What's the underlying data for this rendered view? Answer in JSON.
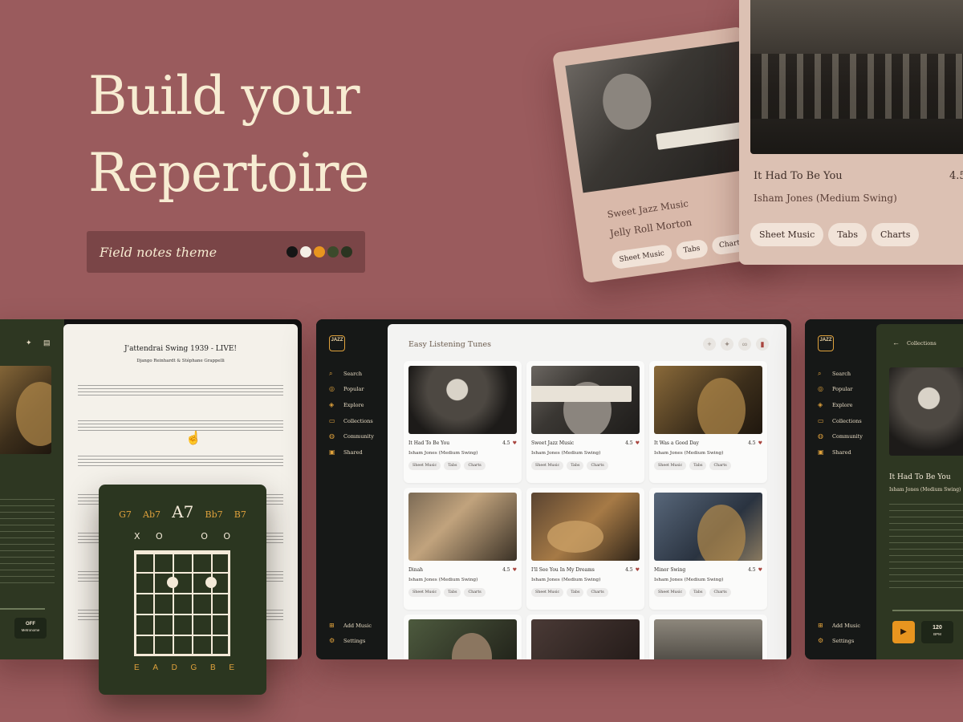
{
  "hero": {
    "title_line1": "Build your",
    "title_line2": "Repertoire"
  },
  "theme": {
    "label": "Field notes theme",
    "swatches": [
      "#151515",
      "#f4efe6",
      "#e8951f",
      "#3b4a2b",
      "#2a3420"
    ]
  },
  "card_a": {
    "title": "Sweet Jazz Music",
    "artist": "Jelly Roll Morton",
    "chips": [
      "Sheet Music",
      "Tabs",
      "Charts"
    ]
  },
  "card_b": {
    "title": "It Had To Be You",
    "rating": "4.5",
    "artist": "Isham Jones (Medium Swing)",
    "chips": [
      "Sheet Music",
      "Tabs",
      "Charts"
    ]
  },
  "nav": {
    "items": [
      {
        "label": "Search",
        "icon": "search-icon"
      },
      {
        "label": "Popular",
        "icon": "popular-icon"
      },
      {
        "label": "Explore",
        "icon": "explore-icon"
      },
      {
        "label": "Collections",
        "icon": "folder-icon"
      },
      {
        "label": "Community",
        "icon": "community-icon"
      },
      {
        "label": "Shared",
        "icon": "shared-icon"
      }
    ],
    "bottom": [
      {
        "label": "Add Music",
        "icon": "plus-icon"
      },
      {
        "label": "Settings",
        "icon": "gear-icon"
      }
    ]
  },
  "logo_text": "JAZZ",
  "main": {
    "title": "Easy Listening Tunes",
    "tiles": [
      {
        "title": "It Had To Be You",
        "artist": "Isham Jones (Medium Swing)",
        "rating": "4.5",
        "chips": [
          "Sheet Music",
          "Tabs",
          "Charts"
        ]
      },
      {
        "title": "Sweet Jazz Music",
        "artist": "Isham Jones (Medium Swing)",
        "rating": "4.5",
        "chips": [
          "Sheet Music",
          "Tabs",
          "Charts"
        ]
      },
      {
        "title": "It Was a Good Day",
        "artist": "Isham Jones (Medium Swing)",
        "rating": "4.5",
        "chips": [
          "Sheet Music",
          "Tabs",
          "Charts"
        ]
      },
      {
        "title": "Dinah",
        "artist": "Isham Jones (Medium Swing)",
        "rating": "4.5",
        "chips": [
          "Sheet Music",
          "Tabs",
          "Charts"
        ]
      },
      {
        "title": "I'll See You In My Dreams",
        "artist": "Isham Jones (Medium Swing)",
        "rating": "4.5",
        "chips": [
          "Sheet Music",
          "Tabs",
          "Charts"
        ]
      },
      {
        "title": "Minor Swing",
        "artist": "Isham Jones (Medium Swing)",
        "rating": "4.5",
        "chips": [
          "Sheet Music",
          "Tabs",
          "Charts"
        ]
      }
    ]
  },
  "sheet": {
    "title": "J'attendrai Swing 1939 - LIVE!",
    "subtitle": "Django Reinhardt & Stéphane Grappelli",
    "chords": [
      "G7",
      "Ab7",
      "A7",
      "Bb7",
      "B7"
    ],
    "strings": [
      "E",
      "A",
      "D",
      "G",
      "B",
      "E"
    ],
    "xo": [
      "X",
      "O",
      "O",
      "O"
    ],
    "metronome": "OFF",
    "metronome_label": "Metronome"
  },
  "right": {
    "breadcrumb": "Collections",
    "title": "It Had To Be You",
    "artist": "Isham Jones (Medium Swing)",
    "bpm": "120",
    "bpm_label": "BPM"
  }
}
